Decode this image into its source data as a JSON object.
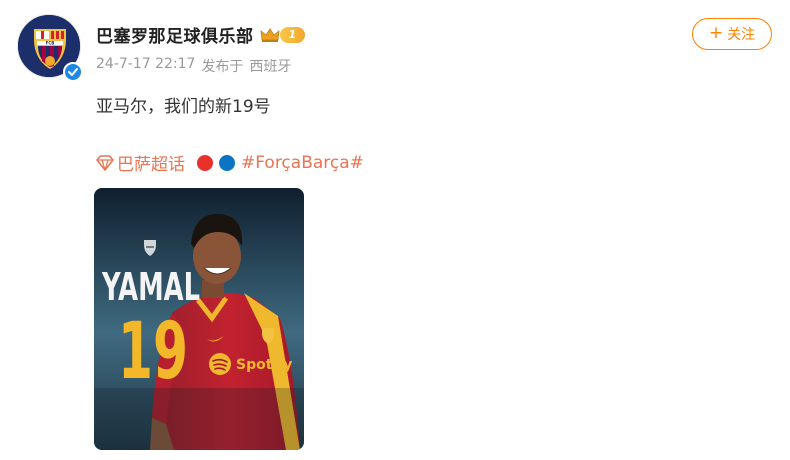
{
  "post": {
    "author": "巴塞罗那足球俱乐部",
    "vip_level": "1",
    "date": "24-7-17 22:17",
    "source": "发布于",
    "location": "西班牙",
    "text": "亚马尔，我们的新19号",
    "topic_label": "巴萨超话",
    "hashtag": "#ForçaBarça#",
    "follow_label": "关注",
    "follow_plus": "+"
  },
  "image": {
    "player_name": "YAMAL",
    "number": "19",
    "sponsor": "Spotify"
  },
  "colors": {
    "accent": "#ff8200",
    "topic": "#eb7350",
    "dot_red": "#e8302d",
    "dot_blue": "#0b74c4",
    "verified": "#1e88e5"
  },
  "icons": {
    "crown": "crown-icon",
    "verified": "verified-check-icon",
    "topic": "diamond-icon"
  }
}
